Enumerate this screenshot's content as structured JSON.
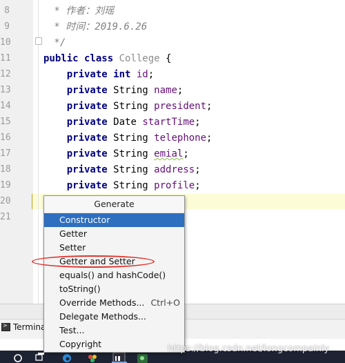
{
  "editor": {
    "line_numbers": [
      "8",
      "9",
      "10",
      "11",
      "12",
      "13",
      "14",
      "15",
      "16",
      "17",
      "18",
      "19",
      "20",
      "21"
    ],
    "lines": [
      {
        "parts": [
          {
            "t": " * 作者：刘瑶",
            "c": "cm"
          }
        ]
      },
      {
        "parts": [
          {
            "t": " * 时间：2019.6.26",
            "c": "cm"
          }
        ]
      },
      {
        "parts": [
          {
            "t": " */",
            "c": "cm"
          }
        ]
      },
      {
        "parts": [
          {
            "t": "public class ",
            "c": "kw"
          },
          {
            "t": "College",
            "c": "cls"
          },
          {
            "t": " {",
            "c": "typ"
          }
        ]
      },
      {
        "parts": [
          {
            "t": "    private int ",
            "c": "kw"
          },
          {
            "t": "id",
            "c": "id"
          },
          {
            "t": ";",
            "c": "typ"
          }
        ]
      },
      {
        "parts": [
          {
            "t": "    private ",
            "c": "kw"
          },
          {
            "t": "String ",
            "c": "typ"
          },
          {
            "t": "name",
            "c": "id"
          },
          {
            "t": ";",
            "c": "typ"
          }
        ]
      },
      {
        "parts": [
          {
            "t": "    private ",
            "c": "kw"
          },
          {
            "t": "String ",
            "c": "typ"
          },
          {
            "t": "president",
            "c": "id"
          },
          {
            "t": ";",
            "c": "typ"
          }
        ]
      },
      {
        "parts": [
          {
            "t": "    private ",
            "c": "kw"
          },
          {
            "t": "Date ",
            "c": "typ"
          },
          {
            "t": "startTime",
            "c": "id"
          },
          {
            "t": ";",
            "c": "typ"
          }
        ]
      },
      {
        "parts": [
          {
            "t": "    private ",
            "c": "kw"
          },
          {
            "t": "String ",
            "c": "typ"
          },
          {
            "t": "telephone",
            "c": "id"
          },
          {
            "t": ";",
            "c": "typ"
          }
        ]
      },
      {
        "parts": [
          {
            "t": "    private ",
            "c": "kw"
          },
          {
            "t": "String ",
            "c": "typ"
          },
          {
            "t": "emial",
            "c": "id squig"
          },
          {
            "t": ";",
            "c": "typ"
          }
        ]
      },
      {
        "parts": [
          {
            "t": "    private ",
            "c": "kw"
          },
          {
            "t": "String ",
            "c": "typ"
          },
          {
            "t": "address",
            "c": "id"
          },
          {
            "t": ";",
            "c": "typ"
          }
        ]
      },
      {
        "parts": [
          {
            "t": "    private ",
            "c": "kw"
          },
          {
            "t": "String ",
            "c": "typ"
          },
          {
            "t": "profile",
            "c": "id"
          },
          {
            "t": ";",
            "c": "typ"
          }
        ]
      },
      {
        "parts": []
      },
      {
        "parts": []
      }
    ]
  },
  "generate_menu": {
    "title": "Generate",
    "items": [
      {
        "label": "Constructor",
        "shortcut": "",
        "selected": true
      },
      {
        "label": "Getter",
        "shortcut": "",
        "selected": false
      },
      {
        "label": "Setter",
        "shortcut": "",
        "selected": false
      },
      {
        "label": "Getter and Setter",
        "shortcut": "",
        "selected": false
      },
      {
        "label": "equals() and hashCode()",
        "shortcut": "",
        "selected": false
      },
      {
        "label": "toString()",
        "shortcut": "",
        "selected": false
      },
      {
        "label": "Override Methods...",
        "shortcut": "Ctrl+O",
        "selected": false
      },
      {
        "label": "Delegate Methods...",
        "shortcut": "",
        "selected": false
      },
      {
        "label": "Test...",
        "shortcut": "",
        "selected": false
      },
      {
        "label": "Copyright",
        "shortcut": "",
        "selected": false
      }
    ]
  },
  "bottom": {
    "terminal_label": "Terminal"
  },
  "watermark": "https://blog.csdn.net/longcompainly",
  "colors": {
    "keyword": "#000080",
    "field": "#660e7a",
    "comment": "#808080",
    "selection": "#2e6fbf",
    "annotation": "#e0342e"
  },
  "taskbar_icons": [
    "search-icon",
    "task-view-icon",
    "edge-icon",
    "color-app-icon",
    "intellij-icon",
    "app-icon"
  ]
}
